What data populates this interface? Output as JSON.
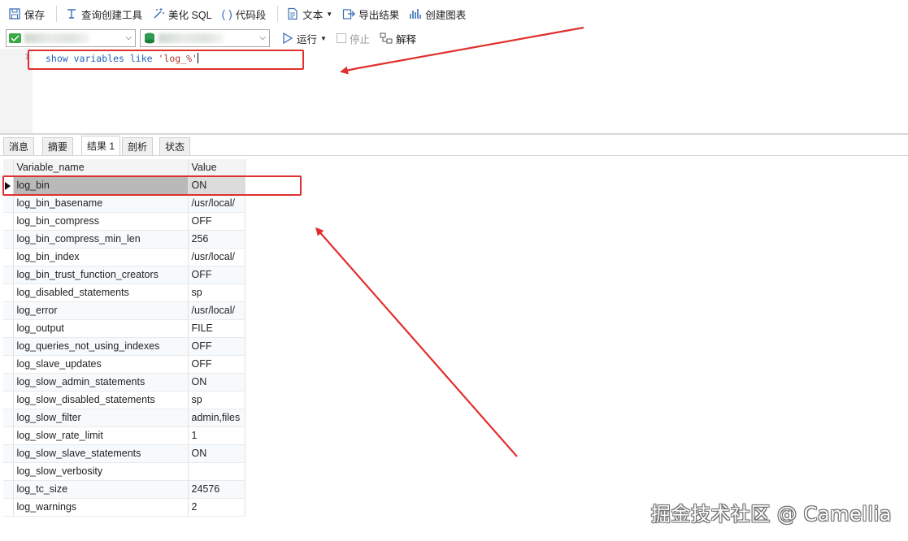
{
  "toolbar": {
    "save": "保存",
    "query_builder": "查询创建工具",
    "beautify_sql": "美化 SQL",
    "code_snippet": "代码段",
    "text": "文本",
    "export_result": "导出结果",
    "create_chart": "创建图表"
  },
  "run_bar": {
    "run": "运行",
    "stop": "停止",
    "explain": "解释"
  },
  "editor": {
    "line_number": "1",
    "sql_keyword": "show variables like ",
    "sql_string": "'log_%'"
  },
  "result_tabs": [
    "消息",
    "摘要",
    "结果 1",
    "剖析",
    "状态"
  ],
  "result_table": {
    "columns": [
      "Variable_name",
      "Value"
    ],
    "rows": [
      [
        "log_bin",
        "ON"
      ],
      [
        "log_bin_basename",
        "/usr/local/"
      ],
      [
        "log_bin_compress",
        "OFF"
      ],
      [
        "log_bin_compress_min_len",
        "256"
      ],
      [
        "log_bin_index",
        "/usr/local/"
      ],
      [
        "log_bin_trust_function_creators",
        "OFF"
      ],
      [
        "log_disabled_statements",
        "sp"
      ],
      [
        "log_error",
        "/usr/local/"
      ],
      [
        "log_output",
        "FILE"
      ],
      [
        "log_queries_not_using_indexes",
        "OFF"
      ],
      [
        "log_slave_updates",
        "OFF"
      ],
      [
        "log_slow_admin_statements",
        "ON"
      ],
      [
        "log_slow_disabled_statements",
        "sp"
      ],
      [
        "log_slow_filter",
        "admin,files"
      ],
      [
        "log_slow_rate_limit",
        "1"
      ],
      [
        "log_slow_slave_statements",
        "ON"
      ],
      [
        "log_slow_verbosity",
        ""
      ],
      [
        "log_tc_size",
        "24576"
      ],
      [
        "log_warnings",
        "2"
      ]
    ]
  },
  "watermark": "掘金技术社区 @ Camellia",
  "colors": {
    "highlight": "#e0302e",
    "selected_row": "#b9b9b9",
    "keyword": "#1f62b8",
    "string": "#b5322b"
  }
}
